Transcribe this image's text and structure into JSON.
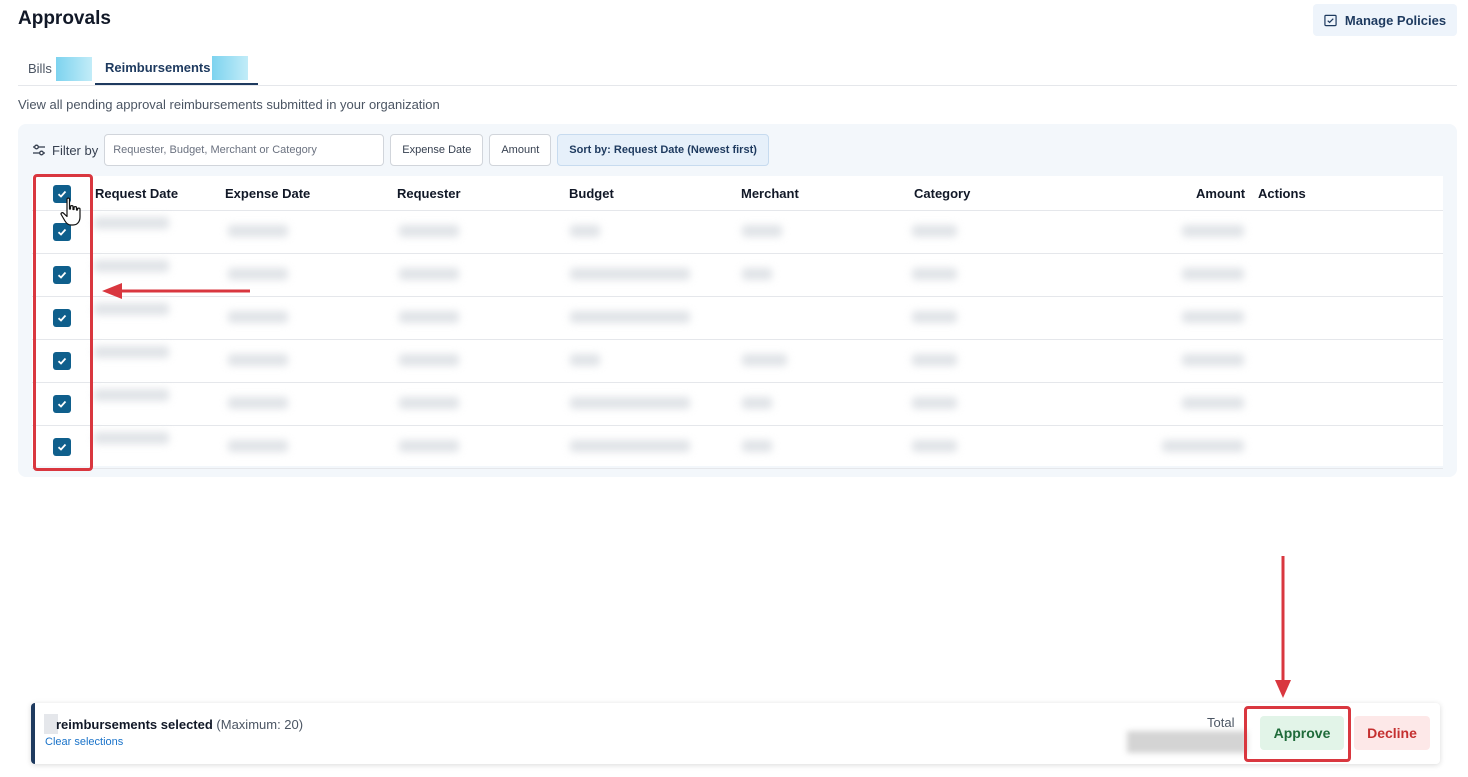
{
  "page": {
    "title": "Approvals",
    "manage_policies_label": "Manage Policies"
  },
  "tabs": [
    {
      "label": "Bills"
    },
    {
      "label": "Reimbursements"
    }
  ],
  "subtitle": "View all pending approval reimbursements submitted in your organization",
  "filter": {
    "label": "Filter by",
    "search_placeholder": "Requester, Budget, Merchant or Category",
    "expense_date_label": "Expense Date",
    "amount_label": "Amount",
    "sort_label": "Sort by: Request Date (Newest first)"
  },
  "table": {
    "columns": [
      "Request Date",
      "Expense Date",
      "Requester",
      "Budget",
      "Merchant",
      "Category",
      "Amount",
      "Actions"
    ],
    "row_count": 6
  },
  "footer": {
    "selected_text": "reimbursements selected",
    "maximum_text": "(Maximum: 20)",
    "clear_label": "Clear selections",
    "total_label": "Total",
    "approve_label": "Approve",
    "decline_label": "Decline"
  },
  "colors": {
    "accent": "#1e3a5f",
    "checkbox": "#0f5f8c",
    "annotation": "#d9373f",
    "approve_bg": "#e2f4e8",
    "decline_bg": "#fde8e8"
  }
}
